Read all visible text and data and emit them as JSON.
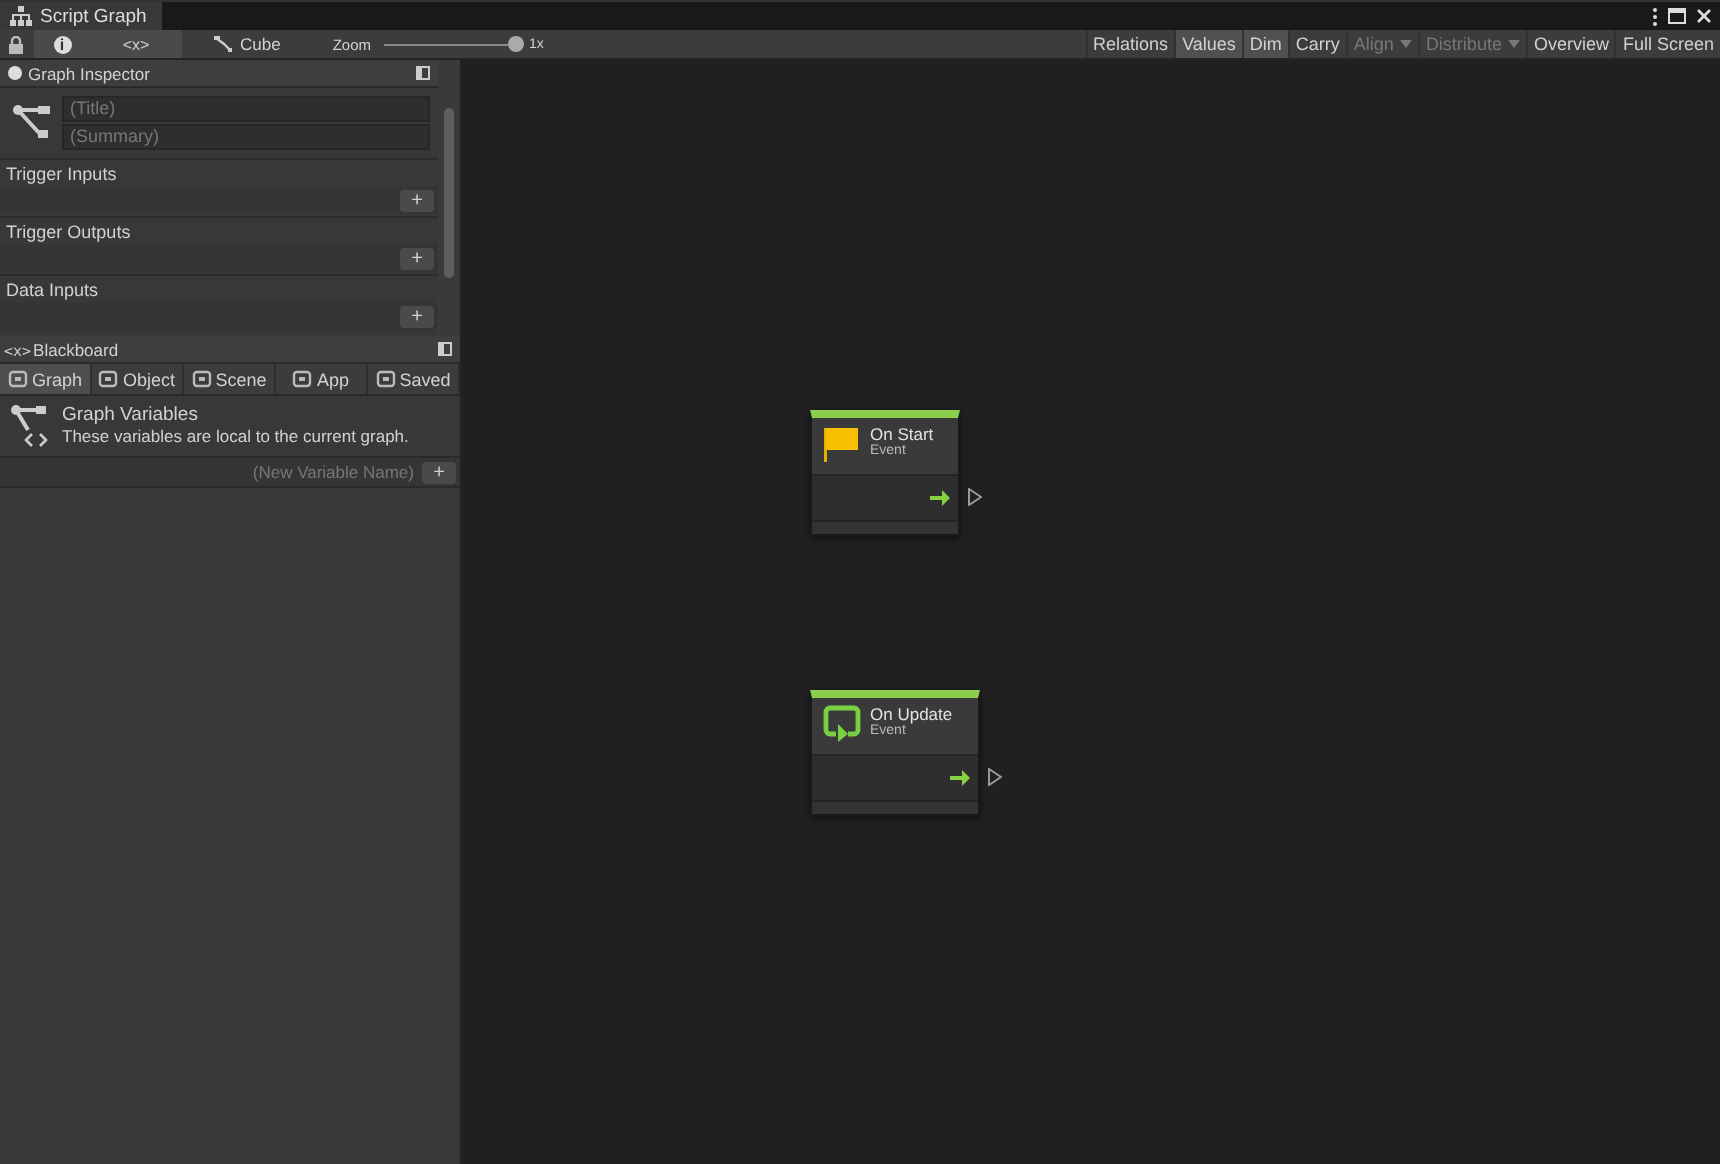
{
  "window": {
    "tab": "Script Graph"
  },
  "toolbar": {
    "toggles": [
      {
        "label": "i",
        "selected": true
      },
      {
        "label": "<x>",
        "selected": true
      }
    ],
    "graph_name": "Cube",
    "zoom": {
      "label": "Zoom",
      "level": 1.0,
      "reading": "1x"
    },
    "buttons": [
      {
        "label": "Relations",
        "selected": false,
        "disabled": false,
        "dropdown": false
      },
      {
        "label": "Values",
        "selected": true,
        "disabled": false,
        "dropdown": false
      },
      {
        "label": "Dim",
        "selected": true,
        "disabled": false,
        "dropdown": false
      },
      {
        "label": "Carry",
        "selected": false,
        "disabled": false,
        "dropdown": false
      },
      {
        "label": "Align",
        "selected": false,
        "disabled": true,
        "dropdown": true
      },
      {
        "label": "Distribute",
        "selected": false,
        "disabled": true,
        "dropdown": true
      },
      {
        "label": "Overview",
        "selected": false,
        "disabled": false,
        "dropdown": false
      },
      {
        "label": "Full Screen",
        "selected": false,
        "disabled": false,
        "dropdown": false
      }
    ]
  },
  "inspector": {
    "title": "Graph Inspector",
    "title_placeholder": "(Title)",
    "summary_placeholder": "(Summary)",
    "add_label": "+",
    "sections": [
      "Trigger Inputs",
      "Trigger Outputs",
      "Data Inputs"
    ]
  },
  "blackboard": {
    "icon_text": "<x>",
    "title": "Blackboard",
    "tabs": [
      {
        "label": "Graph",
        "selected": true
      },
      {
        "label": "Object",
        "selected": false
      },
      {
        "label": "Scene",
        "selected": false
      },
      {
        "label": "App",
        "selected": false
      },
      {
        "label": "Saved",
        "selected": false
      }
    ],
    "heading": "Graph Variables",
    "description": "These variables are local to the current graph.",
    "new_variable_placeholder": "(New Variable Name)",
    "add_label": "+"
  },
  "nodes": [
    {
      "kind": "start",
      "title": "On Start",
      "subtitle": "Event"
    },
    {
      "kind": "update",
      "title": "On Update",
      "subtitle": "Event"
    }
  ]
}
